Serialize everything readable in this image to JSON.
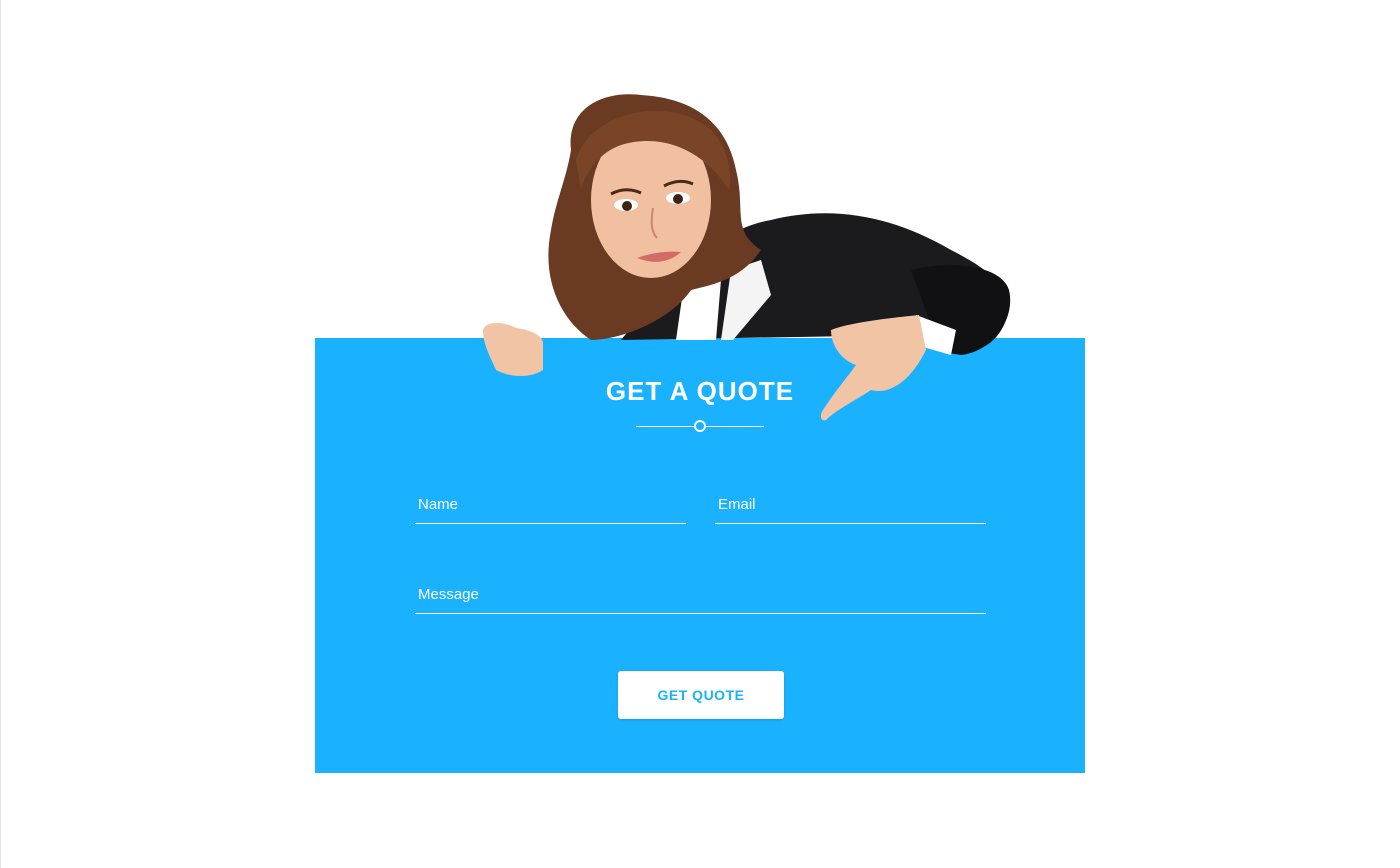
{
  "colors": {
    "panel_background": "#1ab2ff",
    "button_text": "#1ab2ff",
    "text_light": "#ffffff"
  },
  "quote": {
    "title": "GET A QUOTE",
    "name_placeholder": "Name",
    "email_placeholder": "Email",
    "message_placeholder": "Message",
    "submit_label": "GET QUOTE"
  },
  "illustration": {
    "icon": "woman-pointing-illustration"
  }
}
